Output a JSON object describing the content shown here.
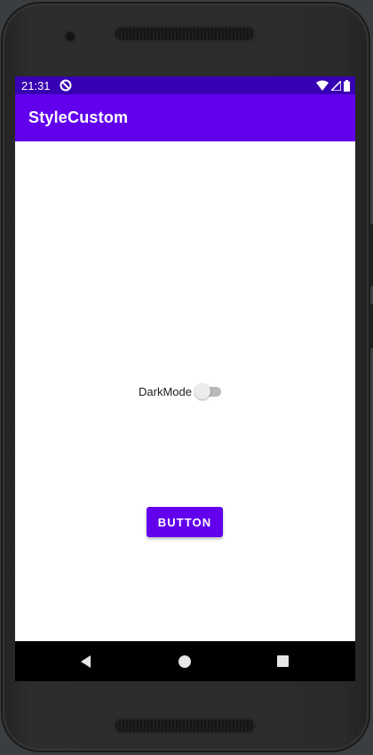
{
  "status_bar": {
    "time": "21:31",
    "icons": [
      "do-not-disturb-icon",
      "wifi-icon",
      "signal-icon",
      "battery-icon"
    ]
  },
  "app_bar": {
    "title": "StyleCustom"
  },
  "content": {
    "dark_mode_switch": {
      "label": "DarkMode",
      "checked": false
    },
    "button": {
      "label": "BUTTON"
    }
  },
  "navigation": {
    "buttons": [
      "back-icon",
      "home-icon",
      "recents-icon"
    ]
  },
  "colors": {
    "status_bar": "#3700b3",
    "primary": "#6200ee",
    "background": "#ffffff",
    "nav_bar": "#000000"
  }
}
